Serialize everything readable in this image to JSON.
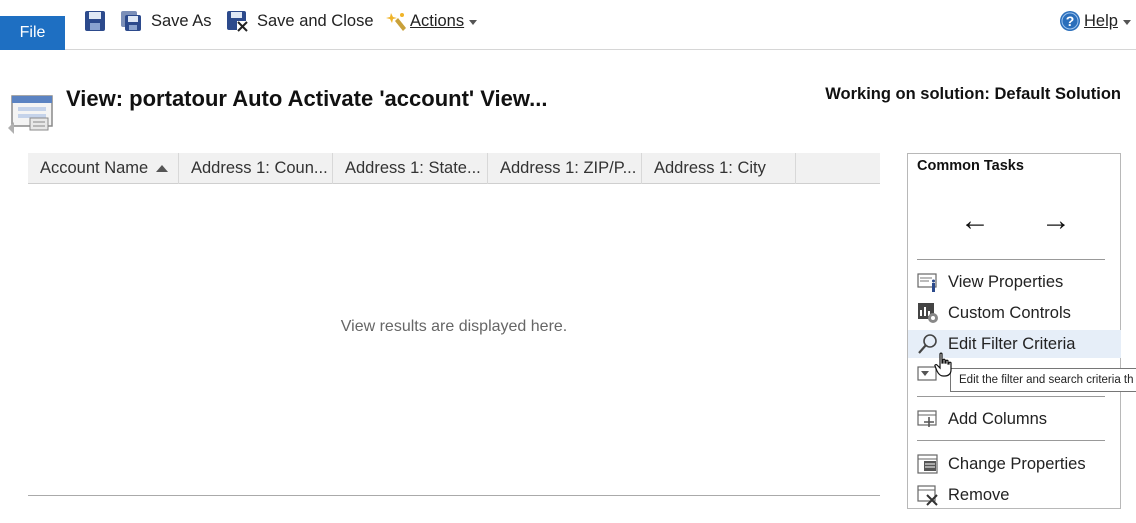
{
  "ribbon": {
    "file_label": "File",
    "save_as_label": "Save As",
    "save_close_label": "Save and Close",
    "actions_label": "Actions",
    "help_label": "Help"
  },
  "header": {
    "title": "View: portatour Auto Activate 'account' View...",
    "solution": "Working on solution: Default Solution"
  },
  "grid": {
    "columns": [
      {
        "label": "Account Name",
        "sorted": "asc"
      },
      {
        "label": "Address 1: Coun..."
      },
      {
        "label": "Address 1: State..."
      },
      {
        "label": "Address 1: ZIP/P..."
      },
      {
        "label": "Address 1: City"
      }
    ],
    "empty_message": "View results are displayed here."
  },
  "tasks": {
    "title": "Common Tasks",
    "back_arrow": "←",
    "forward_arrow": "→",
    "items": [
      {
        "label": "View Properties",
        "icon": "view-properties-icon"
      },
      {
        "label": "Custom Controls",
        "icon": "custom-controls-icon"
      },
      {
        "label": "Edit Filter Criteria",
        "icon": "magnifier-icon"
      },
      {
        "label": "Add Columns",
        "icon": "add-columns-icon"
      },
      {
        "label": "Change Properties",
        "icon": "change-properties-icon"
      },
      {
        "label": "Remove",
        "icon": "remove-icon"
      }
    ],
    "tooltip": "Edit the filter and search criteria th"
  },
  "colors": {
    "file_blue": "#1e6fc2",
    "hover_row": "#e6eef8",
    "help_blue": "#2a6ebb"
  }
}
